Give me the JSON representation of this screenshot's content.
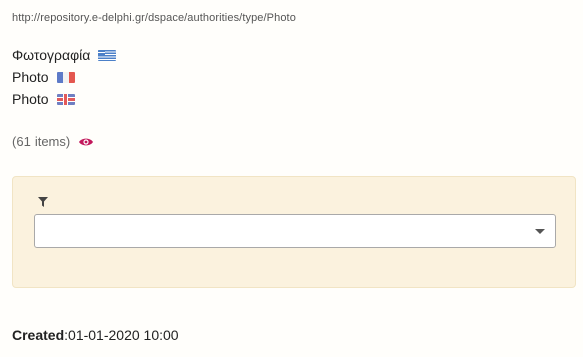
{
  "authority": {
    "uri": "http://repository.e-delphi.gr/dspace/authorities/type/Photo",
    "labels": [
      {
        "text": "Φωτογραφία",
        "lang_flag": "greek-flag-icon"
      },
      {
        "text": "Photo",
        "lang_flag": "french-flag-icon"
      },
      {
        "text": "Photo",
        "lang_flag": "uk-flag-icon"
      }
    ]
  },
  "items": {
    "open_paren": "(",
    "count": "61",
    "label": "items)",
    "icon": "eye-icon",
    "icon_color": "#c2185b"
  },
  "filter": {
    "icon": "filter-icon",
    "select_value": "",
    "background": "#fbf2de"
  },
  "meta": {
    "created_label": "Created",
    "created_sep": ":",
    "created_value": "01-01-2020 10:00"
  }
}
